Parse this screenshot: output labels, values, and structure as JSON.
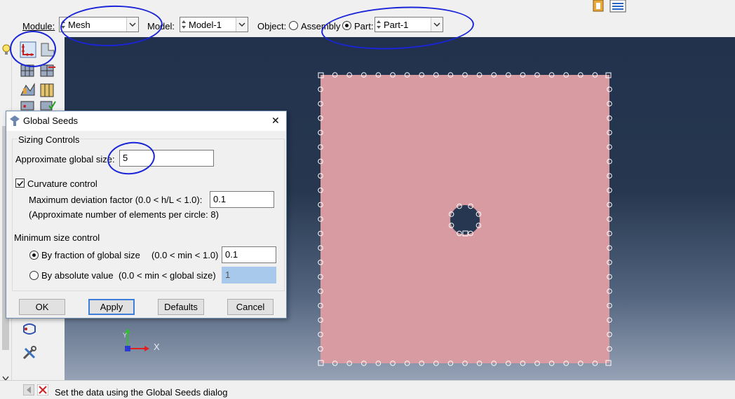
{
  "toolbar": {
    "module_label": "Module:",
    "module_value": "Mesh",
    "model_label": "Model:",
    "model_value": "Model-1",
    "object_label": "Object:",
    "assembly_label": "Assembly",
    "part_label": "Part:",
    "part_value": "Part-1",
    "object_selected": "Part"
  },
  "dialog": {
    "title": "Global Seeds",
    "close_glyph": "✕",
    "sizing_group": "Sizing Controls",
    "global_size_label": "Approximate global size:",
    "global_size_value": "5",
    "curvature_label": "Curvature control",
    "curvature_checked": true,
    "deviation_label": "Maximum deviation factor (0.0 < h/L < 1.0):",
    "deviation_value": "0.1",
    "elements_note": "(Approximate number of elements per circle: 8)",
    "min_size_group": "Minimum size control",
    "fraction_label": "By fraction of global size",
    "fraction_range": "(0.0 < min < 1.0)",
    "fraction_value": "0.1",
    "absolute_label": "By absolute value",
    "absolute_range": "(0.0 < min < global size)",
    "absolute_value": "1",
    "min_size_selected": "fraction",
    "buttons": {
      "ok": "OK",
      "apply": "Apply",
      "defaults": "Defaults",
      "cancel": "Cancel"
    }
  },
  "triad": {
    "x_label": "X"
  },
  "status": {
    "message": "Set the data using the Global Seeds dialog"
  },
  "colors": {
    "viewport_top": "#22324d",
    "viewport_bottom": "#96a2b6",
    "part_fill": "#d89ba2",
    "seed": "#ffffff",
    "annotation": "#1a24d8",
    "axis_green": "#2fbf2f",
    "axis_red": "#e02020",
    "input_highlight": "#a9c9ec"
  },
  "icons": {
    "dialog": "abaqus-seed-icon",
    "status_back": "arrow-left-icon",
    "status_cancel": "red-x-icon"
  }
}
